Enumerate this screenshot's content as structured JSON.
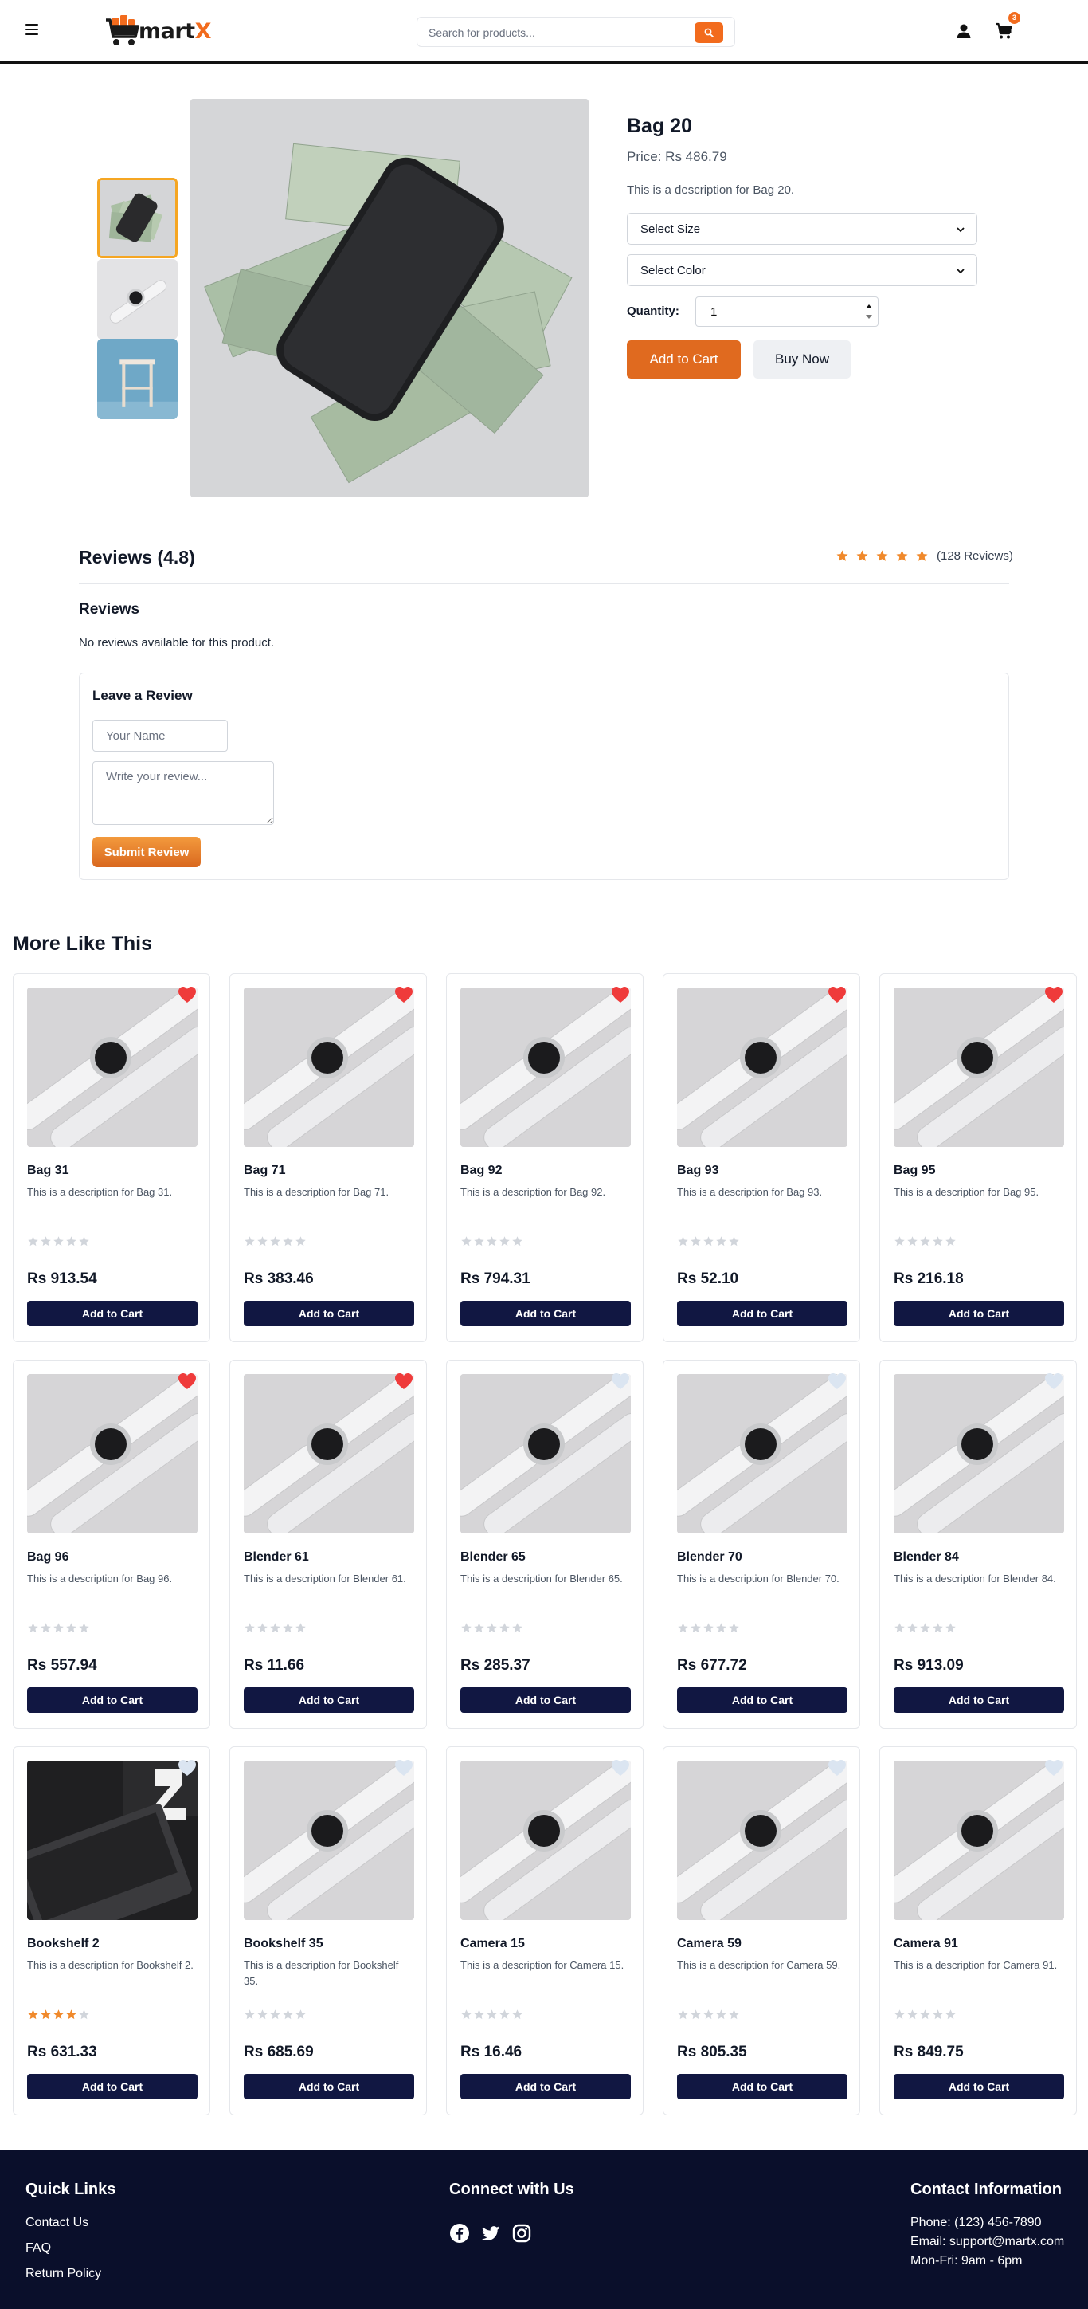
{
  "header": {
    "logo_text": "mart",
    "logo_accent": "X",
    "search_placeholder": "Search for products...",
    "cart_count": "3"
  },
  "product": {
    "title": "Bag 20",
    "price": "Price: Rs 486.79",
    "description": "This is a description for Bag 20.",
    "size_label": "Select Size",
    "color_label": "Select Color",
    "quantity_label": "Quantity:",
    "quantity_value": "1",
    "add_to_cart": "Add to Cart",
    "buy_now": "Buy Now"
  },
  "reviews": {
    "heading": "Reviews (4.8)",
    "rating": 5,
    "count_text": "(128 Reviews)",
    "subheading": "Reviews",
    "empty_text": "No reviews available for this product.",
    "form_title": "Leave a Review",
    "name_placeholder": "Your Name",
    "review_placeholder": "Write your review...",
    "submit": "Submit Review"
  },
  "more": {
    "title": "More Like This",
    "add_label": "Add to Cart",
    "items": [
      {
        "name": "Bag 31",
        "desc": "This is a description for Bag 31.",
        "price": "Rs 913.54",
        "fav": true,
        "rating": 0,
        "image": "watch"
      },
      {
        "name": "Bag 71",
        "desc": "This is a description for Bag 71.",
        "price": "Rs 383.46",
        "fav": true,
        "rating": 0,
        "image": "watch"
      },
      {
        "name": "Bag 92",
        "desc": "This is a description for Bag 92.",
        "price": "Rs 794.31",
        "fav": true,
        "rating": 0,
        "image": "watch"
      },
      {
        "name": "Bag 93",
        "desc": "This is a description for Bag 93.",
        "price": "Rs 52.10",
        "fav": true,
        "rating": 0,
        "image": "watch"
      },
      {
        "name": "Bag 95",
        "desc": "This is a description for Bag 95.",
        "price": "Rs 216.18",
        "fav": true,
        "rating": 0,
        "image": "watch"
      },
      {
        "name": "Bag 96",
        "desc": "This is a description for Bag 96.",
        "price": "Rs 557.94",
        "fav": true,
        "rating": 0,
        "image": "watch"
      },
      {
        "name": "Blender 61",
        "desc": "This is a description for Blender 61.",
        "price": "Rs 11.66",
        "fav": true,
        "rating": 0,
        "image": "watch"
      },
      {
        "name": "Blender 65",
        "desc": "This is a description for Blender 65.",
        "price": "Rs 285.37",
        "fav": false,
        "rating": 0,
        "image": "watch"
      },
      {
        "name": "Blender 70",
        "desc": "This is a description for Blender 70.",
        "price": "Rs 677.72",
        "fav": false,
        "rating": 0,
        "image": "watch"
      },
      {
        "name": "Blender 84",
        "desc": "This is a description for Blender 84.",
        "price": "Rs 913.09",
        "fav": false,
        "rating": 0,
        "image": "watch"
      },
      {
        "name": "Bookshelf 2",
        "desc": "This is a description for Bookshelf 2.",
        "price": "Rs 631.33",
        "fav": false,
        "rating": 4,
        "image": "laptop"
      },
      {
        "name": "Bookshelf 35",
        "desc": "This is a description for Bookshelf 35.",
        "price": "Rs 685.69",
        "fav": false,
        "rating": 0,
        "image": "watch"
      },
      {
        "name": "Camera 15",
        "desc": "This is a description for Camera 15.",
        "price": "Rs 16.46",
        "fav": false,
        "rating": 0,
        "image": "watch"
      },
      {
        "name": "Camera 59",
        "desc": "This is a description for Camera 59.",
        "price": "Rs 805.35",
        "fav": false,
        "rating": 0,
        "image": "watch"
      },
      {
        "name": "Camera 91",
        "desc": "This is a description for Camera 91.",
        "price": "Rs 849.75",
        "fav": false,
        "rating": 0,
        "image": "watch"
      }
    ]
  },
  "footer": {
    "quick_links_title": "Quick Links",
    "links": [
      "Contact Us",
      "FAQ",
      "Return Policy"
    ],
    "connect_title": "Connect with Us",
    "social": [
      "facebook-icon",
      "twitter-icon",
      "instagram-icon"
    ],
    "contact_title": "Contact Information",
    "phone": "Phone: (123) 456-7890",
    "email": "Email: support@martx.com",
    "hours": "Mon-Fri: 9am - 6pm"
  },
  "colors": {
    "accent": "#f26b1d",
    "button_dark": "#111742",
    "footer_bg": "#0a0f2b",
    "heart_active": "#ef3b3b",
    "heart_inactive": "#dbe5f1",
    "star_active": "#f0892b",
    "star_inactive": "#d1d5db"
  }
}
